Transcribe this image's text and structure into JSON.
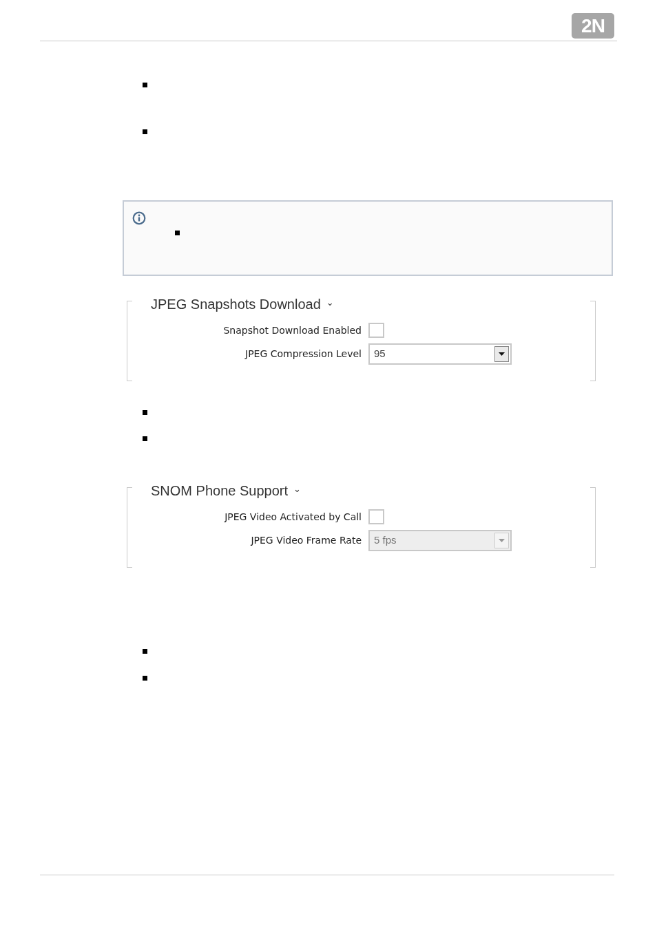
{
  "header": {
    "logo": "2N"
  },
  "blocks": [
    {
      "kind": "bullets",
      "bullets": [
        {
          "kind": "square"
        },
        {
          "kind": "square"
        }
      ]
    },
    {
      "kind": "info",
      "bullets": [
        {
          "kind": "square"
        }
      ]
    },
    {
      "kind": "section",
      "title": "JPEG Snapshots Download",
      "caret": "⌄",
      "fields": [
        {
          "kind": "checkbox",
          "label": "Snapshot Download Enabled",
          "checked": false
        },
        {
          "kind": "select",
          "label": "JPEG Compression Level",
          "value": "95",
          "disabled": false
        }
      ]
    },
    {
      "kind": "bullets",
      "bullets": [
        {
          "kind": "square"
        },
        {
          "kind": "square"
        }
      ]
    },
    {
      "kind": "section",
      "title": "SNOM Phone Support",
      "caret": "⌄",
      "fields": [
        {
          "kind": "checkbox",
          "label": "JPEG Video Activated by Call",
          "checked": false
        },
        {
          "kind": "select",
          "label": "JPEG Video Frame Rate",
          "value": "5 fps",
          "disabled": true
        }
      ]
    },
    {
      "kind": "bullets",
      "bullets": [
        {
          "kind": "square"
        },
        {
          "kind": "square"
        }
      ]
    }
  ]
}
